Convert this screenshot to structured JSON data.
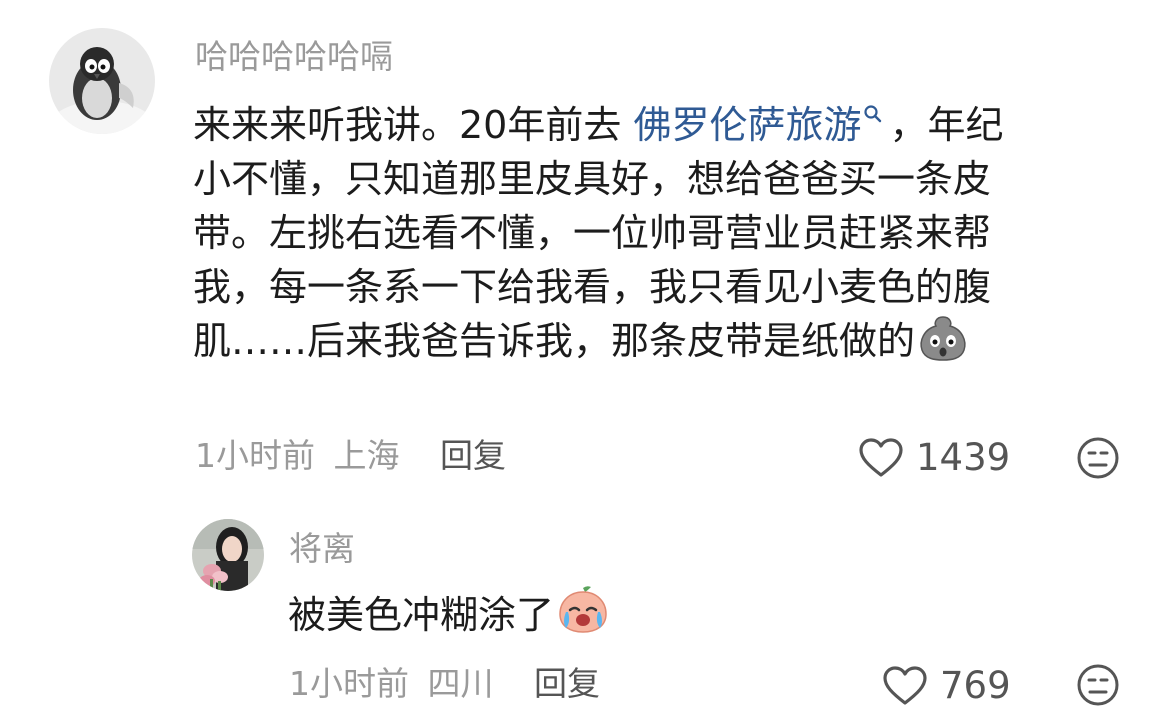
{
  "comments": [
    {
      "username": "哈哈哈哈哈嗝",
      "avatar_icon": "penguin-avatar",
      "text_lines": [
        "来来来听我讲。20年前去 ",
        "小不懂，只知道那里皮具好，想给爸爸买一条皮",
        "带。左挑右选看不懂，一位帅哥营业员赶紧来帮",
        "我，每一条系一下给我看，我只看见小麦色的腹",
        "肌……后来我爸告诉我，那条皮带是纸做的"
      ],
      "link_text": "佛罗伦萨旅游",
      "after_link": "，年纪",
      "trailing_emoji": "dumpling-shocked-emoji",
      "time": "1小时前",
      "location": "上海",
      "reply_label": "回复",
      "likes": "1439"
    },
    {
      "username": "将离",
      "avatar_icon": "woman-with-flowers-avatar",
      "text": "被美色冲糊涂了",
      "trailing_emoji": "crying-peach-emoji",
      "time": "1小时前",
      "location": "四川",
      "reply_label": "回复",
      "likes": "769"
    }
  ],
  "colors": {
    "username": "#9a9a9a",
    "body": "#1c1c1c",
    "link": "#2f5a94",
    "meta": "#9a9a9a"
  }
}
